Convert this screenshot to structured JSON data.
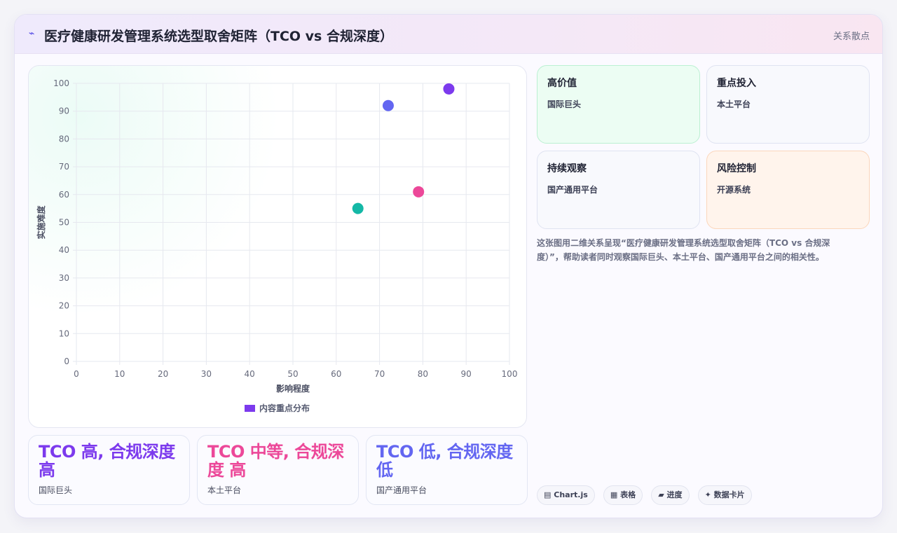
{
  "header": {
    "title": "医疗健康研发管理系统选型取舍矩阵（TCO vs 合规深度）",
    "tag": "关系散点"
  },
  "chart_data": {
    "type": "scatter",
    "xlabel": "影响程度",
    "ylabel": "实施难度",
    "xlim": [
      0,
      100
    ],
    "ylim": [
      0,
      100
    ],
    "xticks": [
      0,
      10,
      20,
      30,
      40,
      50,
      60,
      70,
      80,
      90,
      100
    ],
    "yticks": [
      0,
      10,
      20,
      30,
      40,
      50,
      60,
      70,
      80,
      90,
      100
    ],
    "grid": true,
    "legend_position": "bottom",
    "series": [
      {
        "name": "内容重点分布",
        "color": "#7c3aed",
        "points": [
          {
            "x": 86,
            "y": 98,
            "color": "#7c3aed"
          },
          {
            "x": 72,
            "y": 92,
            "color": "#6366f1"
          },
          {
            "x": 79,
            "y": 61,
            "color": "#ec4899"
          },
          {
            "x": 65,
            "y": 55,
            "color": "#14b8a6"
          }
        ]
      }
    ]
  },
  "stats": [
    {
      "text": "TCO 高, 合规深度 高",
      "label": "国际巨头",
      "color": "#7c3aed"
    },
    {
      "text": "TCO 中等, 合规深度 高",
      "label": "本土平台",
      "color": "#ec4899"
    },
    {
      "text": "TCO 低, 合规深度 低",
      "label": "国产通用平台",
      "color": "#6366f1"
    }
  ],
  "quadrants": [
    {
      "title": "高价值",
      "value": "国际巨头",
      "bg": "#ecfdf3",
      "border": "#bbf0d2"
    },
    {
      "title": "重点投入",
      "value": "本土平台",
      "bg": "#f8f9fd",
      "border": "#dfe3f1"
    },
    {
      "title": "持续观察",
      "value": "国产通用平台",
      "bg": "#f8f9fd",
      "border": "#dfe3f1"
    },
    {
      "title": "风险控制",
      "value": "开源系统",
      "bg": "#fff4ec",
      "border": "#fbd6bb"
    }
  ],
  "description": "这张图用二维关系呈现“医疗健康研发管理系统选型取舍矩阵（TCO vs 合规深度）”，帮助读者同时观察国际巨头、本土平台、国产通用平台之间的相关性。",
  "pills": [
    {
      "icon": "▤",
      "label": "Chart.js"
    },
    {
      "icon": "▦",
      "label": "表格"
    },
    {
      "icon": "▰",
      "label": "进度"
    },
    {
      "icon": "✦",
      "label": "数据卡片"
    }
  ]
}
